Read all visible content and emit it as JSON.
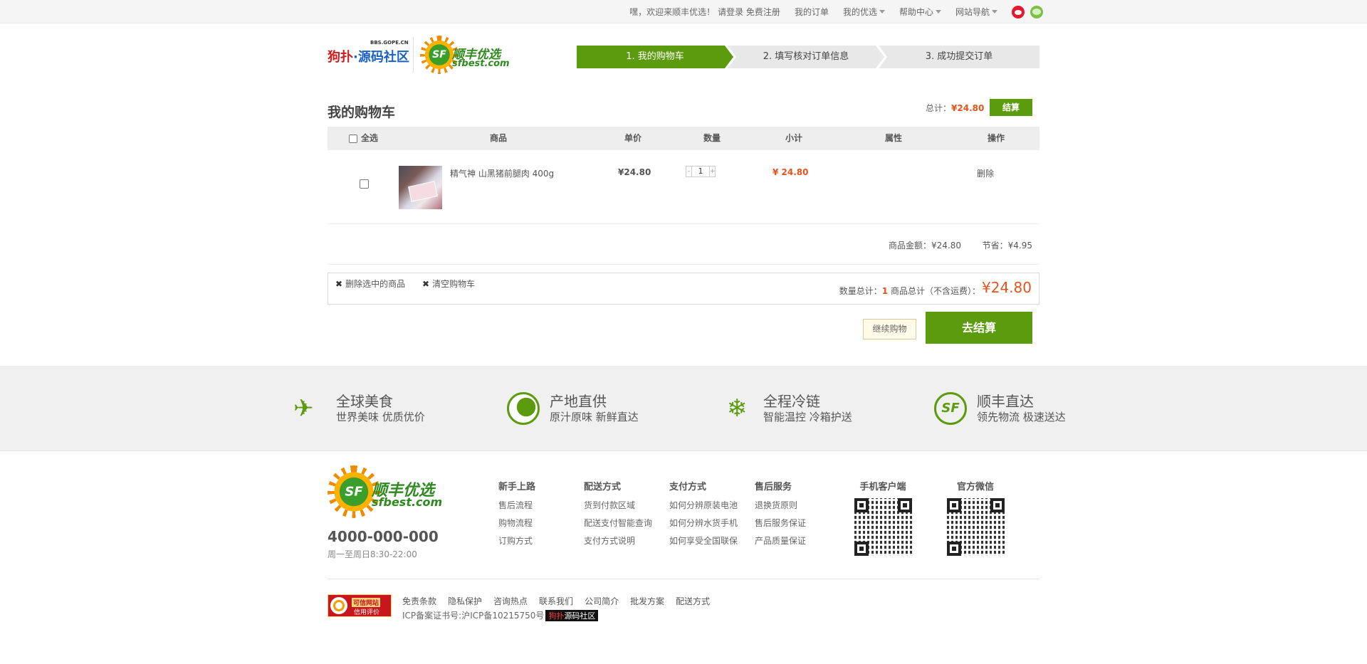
{
  "topbar": {
    "welcome": "嘿，欢迎来顺丰优选！",
    "login_register": "请登录 免费注册",
    "my_orders": "我的订单",
    "my_sfbest": "我的优选",
    "help_center": "帮助中心",
    "site_nav": "网站导航"
  },
  "header": {
    "partner_logo_small": "BBS.GOPE.CN",
    "partner_logo_red": "狗扑",
    "partner_logo_blue": "·源码社区",
    "brand_logo_mark": "SF",
    "brand_cn": "顺丰优选",
    "brand_en": "sfbest.com"
  },
  "steps": [
    "1. 我的购物车",
    "2. 填写核对订单信息",
    "3. 成功提交订单"
  ],
  "cart": {
    "title": "我的购物车",
    "total_label": "总计：",
    "total_value": "¥24.80",
    "settle_small": "结算",
    "columns": {
      "select_all": "全选",
      "product": "商品",
      "unit_price": "单价",
      "quantity": "数量",
      "subtotal": "小计",
      "attributes": "属性",
      "operation": "操作"
    },
    "items": [
      {
        "name": "精气神 山黑猪前腿肉 400g",
        "unit_price": "¥24.80",
        "qty_minus": "-",
        "quantity": "1",
        "qty_plus": "+",
        "subtotal": "¥ 24.80",
        "attributes": "",
        "delete": "删除"
      }
    ],
    "goods_amount_label": "商品金额：",
    "goods_amount": "¥24.80",
    "saved_label": "节省：",
    "saved": "¥4.95",
    "delete_selected": "删除选中的商品",
    "clear_cart": "清空购物车",
    "qty_total_label": "数量总计：",
    "qty_total": "1",
    "goods_total_label": "商品总计（不含运费）：",
    "goods_total": "¥24.80",
    "continue_shopping": "继续购物",
    "checkout": "去结算"
  },
  "features": [
    {
      "icon": "plane-icon",
      "title": "全球美食",
      "sub": "世界美味 优质优价"
    },
    {
      "icon": "globe-icon",
      "title": "产地直供",
      "sub": "原汁原味 新鲜直达"
    },
    {
      "icon": "snowflake-icon",
      "title": "全程冷链",
      "sub": "智能温控 冷箱护送"
    },
    {
      "icon": "sf-icon",
      "title": "顺丰直达",
      "sub": "领先物流 极速送达"
    }
  ],
  "footer": {
    "phone": "4000-000-000",
    "hours": "周一至周日8:30-22:00",
    "columns": [
      {
        "title": "新手上路",
        "items": [
          "售后流程",
          "购物流程",
          "订购方式"
        ]
      },
      {
        "title": "配送方式",
        "items": [
          "货到付款区域",
          "配送支付智能查询",
          "支付方式说明"
        ]
      },
      {
        "title": "支付方式",
        "items": [
          "如何分辨原装电池",
          "如何分辨水货手机",
          "如何享受全国联保"
        ]
      },
      {
        "title": "售后服务",
        "items": [
          "退换货原则",
          "售后服务保证",
          "产品质量保证"
        ]
      }
    ],
    "qr_mobile": "手机客户端",
    "qr_wechat": "官方微信",
    "badge_title": "可信网站",
    "badge_sub": "信用评价",
    "links": [
      "免责条款",
      "隐私保护",
      "咨询热点",
      "联系我们",
      "公司简介",
      "批发方案",
      "配送方式"
    ],
    "icp": "ICP备案证书号:沪ICP备10215750号",
    "icp_tag_red": "狗扑",
    "icp_tag_white": "源码社区"
  }
}
